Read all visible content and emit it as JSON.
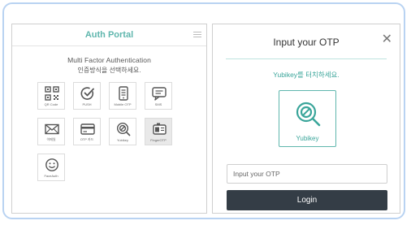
{
  "left_panel": {
    "title": "Auth Portal",
    "heading": "Multi Factor Authentication",
    "subheading": "인증방식을 선택하세요.",
    "methods": [
      {
        "label": "QR Code",
        "icon": "qr-code-icon"
      },
      {
        "label": "PUSH",
        "icon": "check-push-icon"
      },
      {
        "label": "Mobile OTP",
        "icon": "mobile-otp-icon"
      },
      {
        "label": "SMS",
        "icon": "sms-chat-icon"
      },
      {
        "label": "이메일",
        "icon": "email-icon"
      },
      {
        "label": "OTP 카드",
        "icon": "otp-card-icon"
      },
      {
        "label": "Yubikey",
        "icon": "yubikey-icon"
      },
      {
        "label": "FingerOTP",
        "icon": "finger-otp-icon"
      },
      {
        "label": "FaceAuth",
        "icon": "face-auth-icon"
      }
    ],
    "selected_method": "FingerOTP"
  },
  "right_panel": {
    "title": "Input your OTP",
    "close_symbol": "✕",
    "instruction": "Yubikey를 터치하세요.",
    "yubikey_label": "Yubikey",
    "otp_placeholder": "Input your OTP",
    "login_label": "Login"
  },
  "colors": {
    "accent": "#5fb6ad",
    "frame_border": "#b9d3f2",
    "login_bg": "#343d46"
  }
}
